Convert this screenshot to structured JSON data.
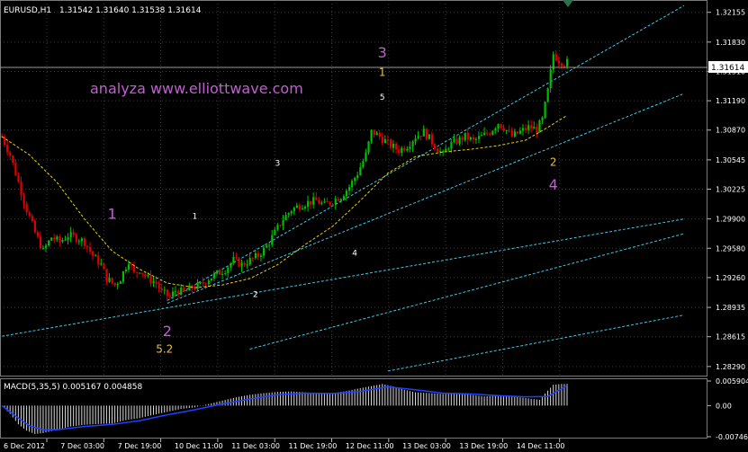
{
  "header": {
    "symbol": "EURUSD,H1",
    "ohlc": "1.31542 1.31640 1.31538 1.31614"
  },
  "watermark": "analyza www.elliottwave.com",
  "colors": {
    "background": "#000000",
    "grid": "#3c3c3c",
    "bull": "#00c000",
    "bear": "#e00000",
    "ma": "#e8d000",
    "trendline": "#40c8e8",
    "wave_major": "#c060d0",
    "wave_minor_yellow": "#e8c040",
    "wave_minor_white": "#ffffff",
    "axis_text": "#ffffff",
    "macd_hist": "#d8d8d8",
    "macd_signal": "#2040ff"
  },
  "chart_data": [
    {
      "type": "candlestick",
      "ylim": [
        1.2821,
        1.3225
      ],
      "y_ticks": [
        "1.32155",
        "1.31830",
        "1.31510",
        "1.31190",
        "1.30870",
        "1.30545",
        "1.30225",
        "1.29900",
        "1.29580",
        "1.29260",
        "1.28935",
        "1.28615",
        "1.28290"
      ],
      "x_ticks": [
        "6 Dec 2012",
        "7 Dec 03:00",
        "7 Dec 19:00",
        "10 Dec 11:00",
        "11 Dec 03:00",
        "11 Dec 19:00",
        "12 Dec 11:00",
        "13 Dec 03:00",
        "13 Dec 19:00",
        "14 Dec 11:00"
      ],
      "current_price": "1.31614",
      "close_path": [
        [
          0,
          1.308
        ],
        [
          3,
          1.306
        ],
        [
          6,
          1.303
        ],
        [
          9,
          1.3
        ],
        [
          12,
          1.2975
        ],
        [
          15,
          1.2955
        ],
        [
          18,
          1.297
        ],
        [
          21,
          1.2965
        ],
        [
          24,
          1.2972
        ],
        [
          27,
          1.297
        ],
        [
          30,
          1.2965
        ],
        [
          33,
          1.295
        ],
        [
          36,
          1.294
        ],
        [
          38,
          1.2925
        ],
        [
          41,
          1.2918
        ],
        [
          43,
          1.2925
        ],
        [
          46,
          1.2945
        ],
        [
          48,
          1.293
        ],
        [
          50,
          1.2935
        ],
        [
          53,
          1.2925
        ],
        [
          56,
          1.292
        ],
        [
          58,
          1.291
        ],
        [
          61,
          1.2905
        ],
        [
          63,
          1.2912
        ],
        [
          66,
          1.291
        ],
        [
          69,
          1.2915
        ],
        [
          72,
          1.2918
        ],
        [
          75,
          1.2925
        ],
        [
          78,
          1.293
        ],
        [
          81,
          1.2935
        ],
        [
          84,
          1.2945
        ],
        [
          87,
          1.294
        ],
        [
          90,
          1.2945
        ],
        [
          93,
          1.295
        ],
        [
          96,
          1.296
        ],
        [
          99,
          1.2975
        ],
        [
          102,
          1.299
        ],
        [
          105,
          1.3
        ],
        [
          108,
          1.3005
        ],
        [
          111,
          1.3008
        ],
        [
          114,
          1.301
        ],
        [
          117,
          1.3005
        ],
        [
          120,
          1.301
        ],
        [
          123,
          1.3015
        ],
        [
          126,
          1.3025
        ],
        [
          129,
          1.304
        ],
        [
          132,
          1.306
        ],
        [
          134,
          1.3085
        ],
        [
          136,
          1.3082
        ],
        [
          139,
          1.3075
        ],
        [
          141,
          1.307
        ],
        [
          144,
          1.3065
        ],
        [
          147,
          1.307
        ],
        [
          150,
          1.308
        ],
        [
          153,
          1.3085
        ],
        [
          155,
          1.3078
        ],
        [
          157,
          1.307
        ],
        [
          160,
          1.306
        ],
        [
          162,
          1.307
        ],
        [
          165,
          1.3075
        ],
        [
          168,
          1.308
        ],
        [
          171,
          1.3075
        ],
        [
          174,
          1.308
        ],
        [
          177,
          1.3085
        ],
        [
          180,
          1.3095
        ],
        [
          182,
          1.309
        ],
        [
          185,
          1.308
        ],
        [
          188,
          1.3085
        ],
        [
          191,
          1.309
        ],
        [
          194,
          1.3088
        ],
        [
          196,
          1.3098
        ],
        [
          198,
          1.313
        ],
        [
          199,
          1.315
        ],
        [
          200,
          1.317
        ],
        [
          202,
          1.3163
        ],
        [
          204,
          1.316
        ],
        [
          205,
          1.3161
        ]
      ],
      "moving_average": [
        [
          0,
          1.308
        ],
        [
          10,
          1.306
        ],
        [
          20,
          1.303
        ],
        [
          30,
          1.299
        ],
        [
          40,
          1.2955
        ],
        [
          50,
          1.2935
        ],
        [
          60,
          1.292
        ],
        [
          70,
          1.2915
        ],
        [
          80,
          1.2918
        ],
        [
          90,
          1.2925
        ],
        [
          100,
          1.294
        ],
        [
          110,
          1.2962
        ],
        [
          120,
          1.2982
        ],
        [
          130,
          1.301
        ],
        [
          140,
          1.304
        ],
        [
          150,
          1.3058
        ],
        [
          160,
          1.3063
        ],
        [
          170,
          1.3066
        ],
        [
          180,
          1.307
        ],
        [
          190,
          1.3076
        ],
        [
          198,
          1.309
        ],
        [
          205,
          1.3103
        ]
      ],
      "trendlines": [
        {
          "x1": 0,
          "y1": 1.2862,
          "x2": 205,
          "y2": 1.2968
        },
        {
          "x1": 60,
          "y1": 1.2901,
          "x2": 205,
          "y2": 1.315
        },
        {
          "x1": 60,
          "y1": 1.2898,
          "x2": 205,
          "y2": 1.3075
        },
        {
          "x1": 90,
          "y1": 1.2848,
          "x2": 205,
          "y2": 1.294
        },
        {
          "x1": 140,
          "y1": 1.2824,
          "x2": 205,
          "y2": 1.2861
        }
      ],
      "wave_labels": [
        {
          "text": "3",
          "x": 138,
          "price": 1.3166,
          "color": "wave_major",
          "size": "large"
        },
        {
          "text": "1",
          "x": 138,
          "price": 1.3146,
          "color": "wave_minor_yellow",
          "size": "small"
        },
        {
          "text": "5",
          "x": 138,
          "price": 1.312,
          "color": "wave_minor_white",
          "size": "tiny"
        },
        {
          "text": "1",
          "x": 40,
          "price": 1.299,
          "color": "wave_major",
          "size": "large"
        },
        {
          "text": "1",
          "x": 70,
          "price": 1.299,
          "color": "wave_minor_white",
          "size": "tiny"
        },
        {
          "text": "3",
          "x": 100,
          "price": 1.3048,
          "color": "wave_minor_white",
          "size": "tiny"
        },
        {
          "text": "4",
          "x": 128,
          "price": 1.295,
          "color": "wave_minor_white",
          "size": "tiny"
        },
        {
          "text": "2",
          "x": 92,
          "price": 1.2905,
          "color": "wave_minor_white",
          "size": "tiny"
        },
        {
          "text": "2",
          "x": 60,
          "price": 1.2862,
          "color": "wave_major",
          "size": "large"
        },
        {
          "text": "5.2",
          "x": 59,
          "price": 1.2844,
          "color": "wave_minor_yellow",
          "size": "small"
        },
        {
          "text": "2",
          "x": 200,
          "price": 1.3048,
          "color": "wave_minor_yellow",
          "size": "small"
        },
        {
          "text": "4",
          "x": 200,
          "price": 1.3022,
          "color": "wave_major",
          "size": "large"
        }
      ]
    },
    {
      "type": "bar",
      "label": "MACD(5,35,5) 0.005167 0.004858",
      "y_ticks": [
        "0.005904",
        "0.00",
        "-0.00746"
      ],
      "ylim": [
        -0.00746,
        0.005904
      ],
      "histogram": [
        [
          0,
          0.0
        ],
        [
          3,
          -0.002
        ],
        [
          6,
          -0.0045
        ],
        [
          9,
          -0.006
        ],
        [
          12,
          -0.0068
        ],
        [
          15,
          -0.0066
        ],
        [
          20,
          -0.0058
        ],
        [
          25,
          -0.005
        ],
        [
          30,
          -0.0046
        ],
        [
          35,
          -0.0044
        ],
        [
          40,
          -0.0043
        ],
        [
          45,
          -0.0035
        ],
        [
          50,
          -0.003
        ],
        [
          55,
          -0.0022
        ],
        [
          60,
          -0.0015
        ],
        [
          65,
          -0.0008
        ],
        [
          70,
          -0.0004
        ],
        [
          75,
          0.0004
        ],
        [
          80,
          0.0012
        ],
        [
          85,
          0.002
        ],
        [
          90,
          0.0026
        ],
        [
          95,
          0.003
        ],
        [
          100,
          0.0033
        ],
        [
          105,
          0.0034
        ],
        [
          110,
          0.0032
        ],
        [
          115,
          0.0028
        ],
        [
          120,
          0.003
        ],
        [
          125,
          0.0035
        ],
        [
          130,
          0.0042
        ],
        [
          135,
          0.0048
        ],
        [
          138,
          0.0052
        ],
        [
          142,
          0.0046
        ],
        [
          146,
          0.0038
        ],
        [
          150,
          0.0032
        ],
        [
          155,
          0.003
        ],
        [
          160,
          0.0028
        ],
        [
          165,
          0.003
        ],
        [
          170,
          0.0026
        ],
        [
          175,
          0.0022
        ],
        [
          180,
          0.0024
        ],
        [
          185,
          0.0022
        ],
        [
          190,
          0.0018
        ],
        [
          195,
          0.0014
        ],
        [
          198,
          0.0036
        ],
        [
          200,
          0.005
        ],
        [
          203,
          0.0052
        ],
        [
          205,
          0.0052
        ]
      ],
      "signal": [
        [
          0,
          0.0
        ],
        [
          5,
          -0.0025
        ],
        [
          10,
          -0.0048
        ],
        [
          15,
          -0.0058
        ],
        [
          20,
          -0.0058
        ],
        [
          30,
          -0.005
        ],
        [
          40,
          -0.0045
        ],
        [
          50,
          -0.0036
        ],
        [
          60,
          -0.0022
        ],
        [
          70,
          -0.001
        ],
        [
          80,
          0.0004
        ],
        [
          90,
          0.0016
        ],
        [
          100,
          0.0026
        ],
        [
          110,
          0.003
        ],
        [
          120,
          0.0029
        ],
        [
          130,
          0.0034
        ],
        [
          140,
          0.0045
        ],
        [
          150,
          0.0038
        ],
        [
          160,
          0.003
        ],
        [
          170,
          0.0028
        ],
        [
          180,
          0.0024
        ],
        [
          190,
          0.0021
        ],
        [
          198,
          0.0022
        ],
        [
          205,
          0.0048
        ]
      ]
    }
  ]
}
